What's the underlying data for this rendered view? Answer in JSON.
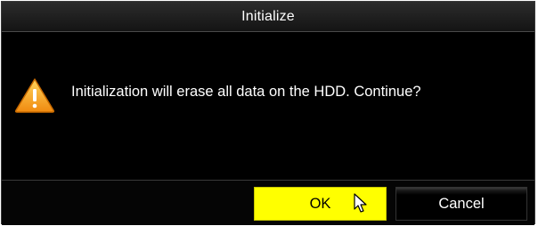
{
  "dialog": {
    "title": "Initialize",
    "message": "Initialization will erase all data on the HDD. Continue?",
    "icon": "warning-icon",
    "ok_label": "OK",
    "cancel_label": "Cancel"
  },
  "colors": {
    "background": "#000000",
    "title_text": "#ffffff",
    "ok_button": "#ffff00",
    "warning_icon": "#f5a623"
  }
}
